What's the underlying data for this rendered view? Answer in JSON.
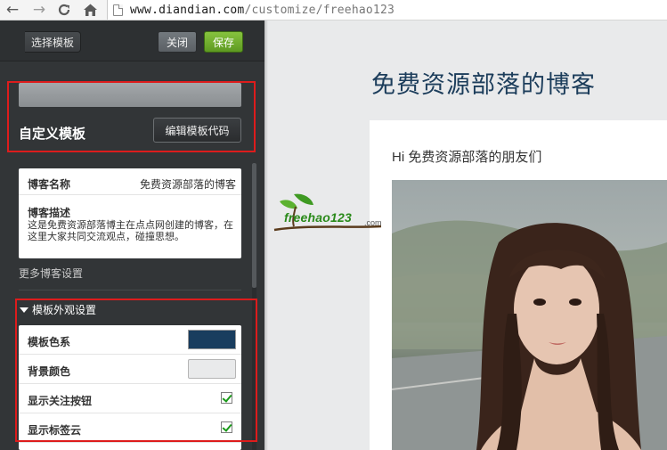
{
  "browser": {
    "back_icon": "back-arrow-icon",
    "forward_icon": "forward-arrow-icon",
    "reload_icon": "reload-icon",
    "home_icon": "home-icon",
    "url_host": "www.diandian.com",
    "url_path": "/customize/freehao123"
  },
  "toolbar": {
    "select_template_label": "选择模板",
    "close_label": "关闭",
    "save_label": "保存"
  },
  "template": {
    "title": "自定义模板",
    "edit_code_label": "编辑模板代码"
  },
  "blog_info": {
    "name_label": "博客名称",
    "name_value": "免费资源部落的博客",
    "desc_label": "博客描述",
    "desc_value": "这是免费资源部落博主在点点网创建的博客，在这里大家共同交流观点，碰撞思想。",
    "more_settings": "更多博客设置"
  },
  "appearance": {
    "heading": "模板外观设置",
    "rows": [
      {
        "label": "模板色系",
        "control": "color",
        "value": "#193d5e"
      },
      {
        "label": "背景颜色",
        "control": "color",
        "value": "#e9eaeb"
      },
      {
        "label": "显示关注按钮",
        "control": "checkbox",
        "checked": true
      },
      {
        "label": "显示标签云",
        "control": "checkbox",
        "checked": true
      }
    ]
  },
  "preview": {
    "blog_title": "免费资源部落的博客",
    "post_greeting": "Hi 免费资源部落的朋友们",
    "photo": "portrait-photo"
  },
  "watermark": {
    "brand": "freehao123",
    "suffix": ".com"
  },
  "colors": {
    "panel_bg": "#323537",
    "save_green": "#6aa82c",
    "title_navy": "#1c3d5b",
    "highlight_red": "#dd1c1c"
  }
}
